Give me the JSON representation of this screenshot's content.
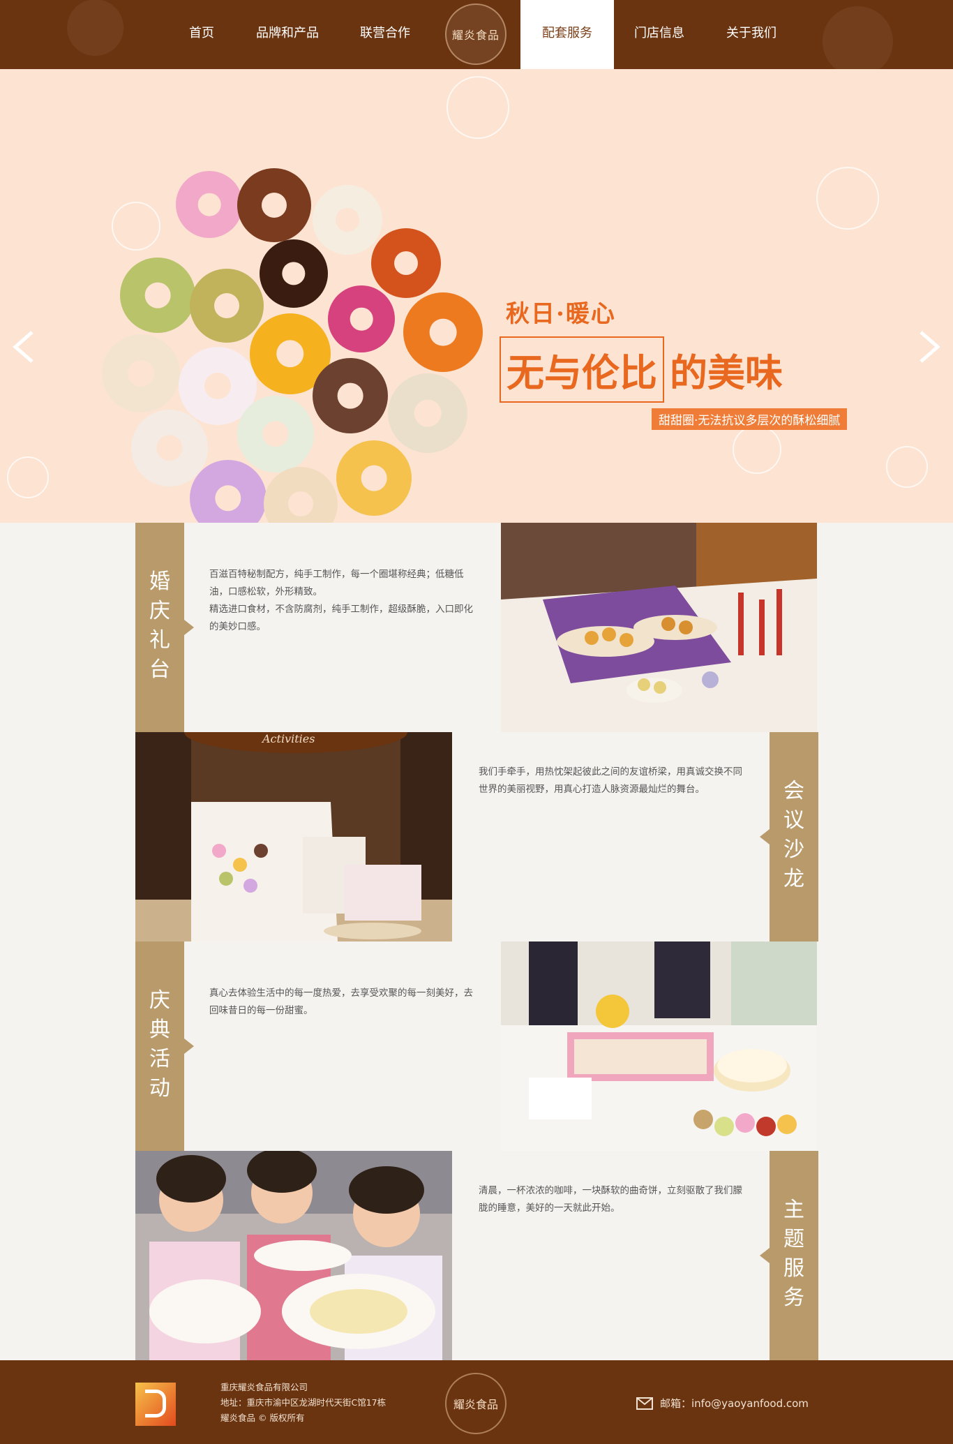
{
  "nav": {
    "items": [
      {
        "label": "首页"
      },
      {
        "label": "品牌和产品"
      },
      {
        "label": "联营合作"
      },
      {
        "label": "配套服务"
      },
      {
        "label": "门店信息"
      },
      {
        "label": "关于我们"
      }
    ],
    "logo_text": "耀炎食品",
    "active_label": "配套服务"
  },
  "banner": {
    "subtitle": "秋日·暖心",
    "title_boxed": "无与伦比",
    "title_rest": "的美味",
    "tagline": "甜甜圈·无法抗议多层次的酥松细腻"
  },
  "services": [
    {
      "label": "婚庆礼台",
      "label_chars": [
        "婚",
        "庆",
        "礼",
        "台"
      ],
      "desc": [
        "百滋百特秘制配方，纯手工制作，每一个圈堪称经典；低糖低油，口感松软，外形精致。",
        "精选进口食材，不含防腐剂，纯手工制作，超级酥脆，入口即化的美妙口感。"
      ]
    },
    {
      "label": "会议沙龙",
      "label_chars": [
        "会",
        "议",
        "沙",
        "龙"
      ],
      "desc": [
        "我们手牵手，用热忱架起彼此之间的友谊桥梁，用真诚交换不同世界的美丽视野，用真心打造人脉资源最灿烂的舞台。"
      ],
      "photo_text": "Activities"
    },
    {
      "label": "庆典活动",
      "label_chars": [
        "庆",
        "典",
        "活",
        "动"
      ],
      "desc": [
        "真心去体验生活中的每一度热爱，去享受欢聚的每一刻美好，去回味昔日的每一份甜蜜。"
      ]
    },
    {
      "label": "主题服务",
      "label_chars": [
        "主",
        "题",
        "服",
        "务"
      ],
      "desc": [
        "清晨，一杯浓浓的咖啡，一块酥软的曲奇饼，立刻驱散了我们朦胧的睡意，美好的一天就此开始。"
      ]
    }
  ],
  "footer": {
    "company": "重庆耀炎食品有限公司",
    "address": "地址：重庆市渝中区龙湖时代天街C馆17栋",
    "copyright": "耀炎食品 © 版权所有",
    "logo_text": "耀炎食品",
    "email": "邮箱：info@yaoyanfood.com"
  },
  "colors": {
    "brown": "#6b3410",
    "band": "#b89a6b",
    "banner_bg": "#fde3d2",
    "accent": "#e9681f"
  }
}
